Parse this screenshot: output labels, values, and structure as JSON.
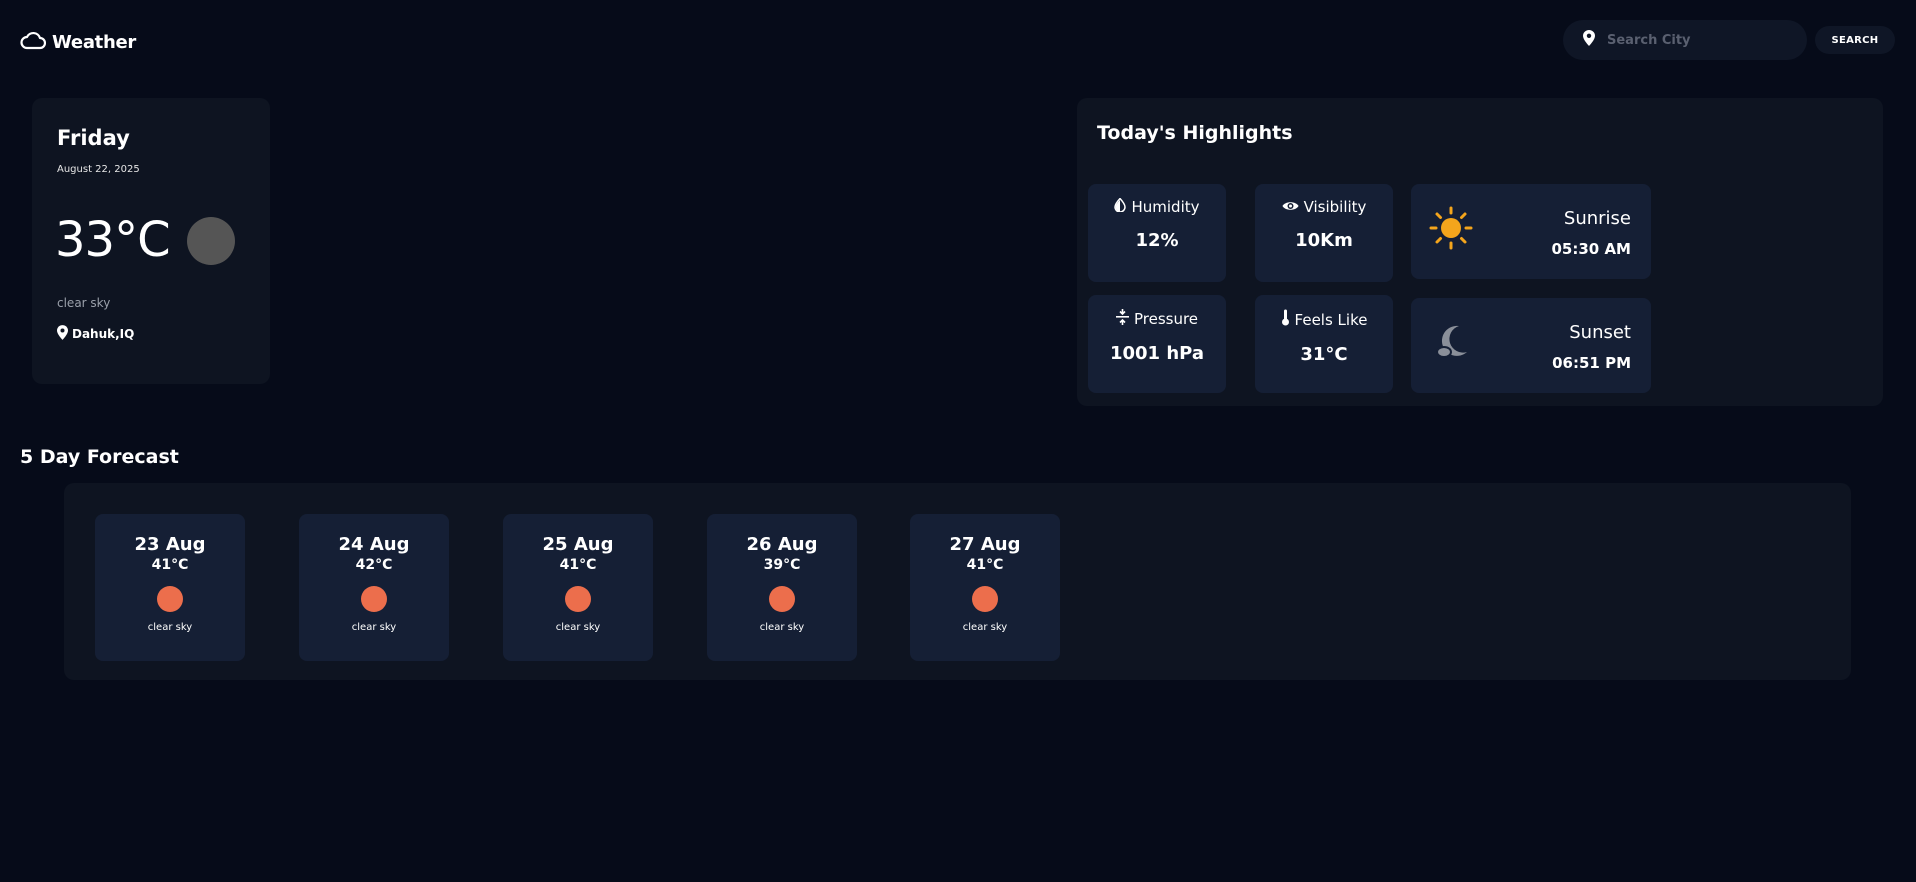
{
  "header": {
    "title": "Weather",
    "search_placeholder": "Search City",
    "search_button": "SEARCH",
    "logo_icon": "cloud-icon",
    "search_icon": "location-pin-icon"
  },
  "current": {
    "day": "Friday",
    "date": "August 22, 2025",
    "temp": "33°C",
    "description": "clear sky",
    "location": "Dahuk,IQ",
    "icon": "weather-icon-placeholder"
  },
  "highlights": {
    "title": "Today's Highlights",
    "humidity": {
      "label": "Humidity",
      "value": "12%",
      "icon": "droplet-icon"
    },
    "visibility": {
      "label": "Visibility",
      "value": "10Km",
      "icon": "eye-icon"
    },
    "pressure": {
      "label": "Pressure",
      "value": "1001 hPa",
      "icon": "pressure-icon"
    },
    "feels_like": {
      "label": "Feels Like",
      "value": "31°C",
      "icon": "thermometer-icon"
    },
    "sunrise": {
      "label": "Sunrise",
      "time": "05:30 AM",
      "icon": "sun-icon"
    },
    "sunset": {
      "label": "Sunset",
      "time": "06:51 PM",
      "icon": "moon-icon"
    }
  },
  "forecast": {
    "title": "5 Day Forecast",
    "days": [
      {
        "date": "23 Aug",
        "temp": "41°C",
        "description": "clear sky"
      },
      {
        "date": "24 Aug",
        "temp": "42°C",
        "description": "clear sky"
      },
      {
        "date": "25 Aug",
        "temp": "41°C",
        "description": "clear sky"
      },
      {
        "date": "26 Aug",
        "temp": "39°C",
        "description": "clear sky"
      },
      {
        "date": "27 Aug",
        "temp": "41°C",
        "description": "clear sky"
      }
    ]
  },
  "colors": {
    "background": "#060b19",
    "card": "#0e1421",
    "tile": "#151f35",
    "sun": "#f4a51c",
    "forecast_icon": "#ec6e4c"
  }
}
